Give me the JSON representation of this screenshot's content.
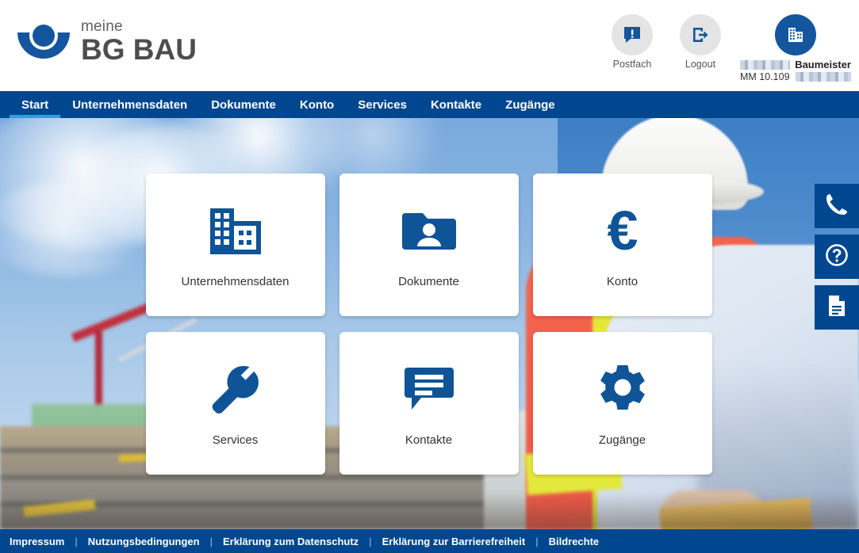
{
  "header": {
    "logo": {
      "top_text": "meine",
      "main_text": "BG BAU",
      "icon": "bgbau-logo-mark"
    },
    "actions": [
      {
        "label": "Postfach",
        "icon": "message-alert-icon"
      },
      {
        "label": "Logout",
        "icon": "logout-arrow-icon"
      }
    ],
    "user": {
      "icon": "company-building-icon",
      "name_visible": "Baumeister",
      "name_redacted": true,
      "id_label": "MM 10.109",
      "id_redacted": true
    }
  },
  "nav": {
    "items": [
      {
        "label": "Start",
        "active": true
      },
      {
        "label": "Unternehmensdaten",
        "active": false
      },
      {
        "label": "Dokumente",
        "active": false
      },
      {
        "label": "Konto",
        "active": false
      },
      {
        "label": "Services",
        "active": false
      },
      {
        "label": "Kontakte",
        "active": false
      },
      {
        "label": "Zugänge",
        "active": false
      }
    ],
    "active_underline_color": "#27a3dd",
    "background_color": "#00478f"
  },
  "tiles": [
    {
      "label": "Unternehmensdaten",
      "icon": "office-building-icon"
    },
    {
      "label": "Dokumente",
      "icon": "folder-person-icon"
    },
    {
      "label": "Konto",
      "icon": "euro-sign-icon"
    },
    {
      "label": "Services",
      "icon": "wrench-icon"
    },
    {
      "label": "Kontakte",
      "icon": "speech-bubble-icon"
    },
    {
      "label": "Zugänge",
      "icon": "gear-icon"
    }
  ],
  "side_actions": [
    {
      "icon": "phone-icon",
      "name": "contact-phone-button"
    },
    {
      "icon": "question-mark-circle-icon",
      "name": "help-button"
    },
    {
      "icon": "document-icon",
      "name": "document-button"
    }
  ],
  "footer": {
    "links": [
      "Impressum",
      "Nutzungsbedingungen",
      "Erklärung zum Datenschutz",
      "Erklärung zur Barrierefreiheit",
      "Bildrechte"
    ],
    "separator": "|",
    "background_color": "#00478f"
  },
  "colors": {
    "brand_blue": "#14569e",
    "nav_blue": "#00478f",
    "accent_cyan": "#27a3dd",
    "icon_blue": "#0f5496",
    "logo_gray": "#4d4d4d"
  },
  "background": {
    "description": "construction site with worker in hi-vis vest and white helmet under blue sky"
  }
}
